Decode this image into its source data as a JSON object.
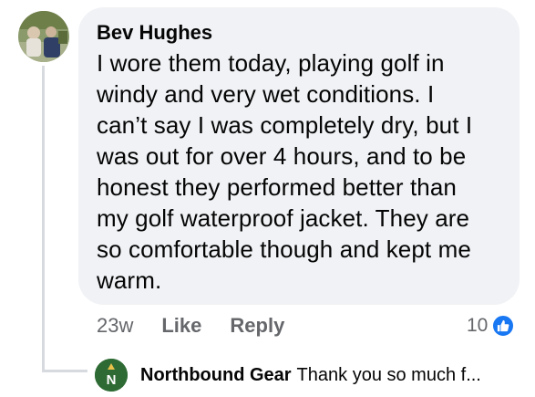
{
  "comment": {
    "author": "Bev Hughes",
    "lines": [
      "I wore them today, playing golf in",
      "windy and very wet conditions. I",
      "can’t say I was completely dry, but I",
      "was out for over 4 hours, and to be",
      "honest they performed better than",
      "my golf waterproof jacket. They are",
      "so comfortable though and kept me",
      "warm."
    ],
    "timestamp": "23w",
    "like_label": "Like",
    "reply_label": "Reply",
    "reaction_count": "10",
    "reaction_icon": "thumbs-up-icon",
    "accent_color": "#1877f2"
  },
  "reply": {
    "author": "Northbound Gear",
    "preview": "Thank you so much f...",
    "avatar_letter": "N",
    "avatar_color": "#2e6b34"
  }
}
